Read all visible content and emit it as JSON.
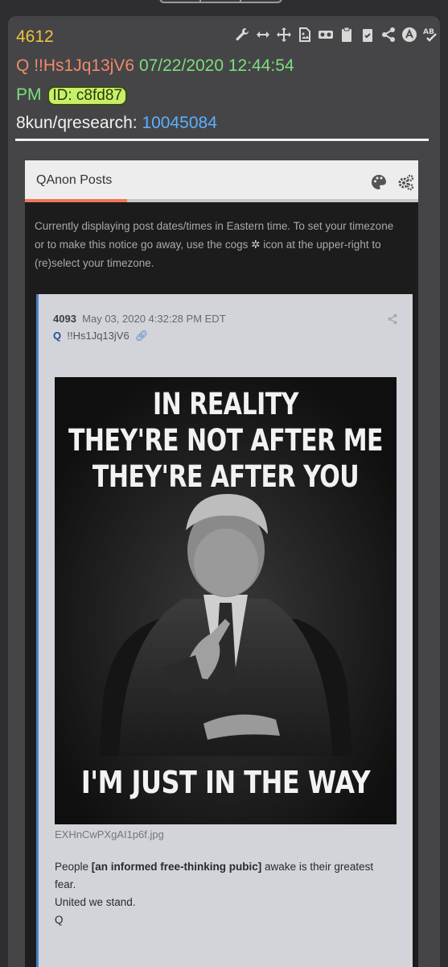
{
  "post": {
    "number": "4612",
    "author": "Q",
    "tripcode": "!!Hs1Jq13jV6",
    "date": "07/22/2020 12:44:54",
    "ampm": "PM",
    "id_label": "ID: c8fd87",
    "board": "8kun/qresearch:",
    "ref_number": "10045084"
  },
  "toolbar_icons": [
    "wrench-icon",
    "resize-horizontal-icon",
    "move-icon",
    "image-file-icon",
    "vr-goggles-icon",
    "clipboard-icon",
    "clipboard-check-icon",
    "share-icon",
    "a-circle-icon",
    "ab-spellcheck-icon"
  ],
  "embedded": {
    "title": "QAnon Posts",
    "notice_line1": "Currently displaying post dates/times in Eastern time. To set your timezone",
    "notice_line2a": "or to make this notice go away, use the cogs",
    "notice_line2b": "icon at the upper-right to",
    "notice_line3": "(re)select your timezone.",
    "inner_post": {
      "number": "4093",
      "date": "May 03, 2020 4:32:28 PM EDT",
      "author": "Q",
      "tripcode": "!!Hs1Jq13jV6",
      "meme_top_line1": "IN REALITY",
      "meme_top_line2": "THEY'RE NOT AFTER ME",
      "meme_top_line3": "THEY'RE AFTER YOU",
      "meme_bottom": "I'M JUST IN THE WAY",
      "filename": "EXHnCwPXgAI1p6f.jpg",
      "body_pre": "People ",
      "body_bold": "[an informed free-thinking pubic]",
      "body_post": " awake is their greatest fear.",
      "body_line2": "United we stand.",
      "body_line3": "Q"
    }
  },
  "colors": {
    "post_number": "#f0c23b",
    "author": "#f08a6a",
    "date": "#7dde7d",
    "link": "#5ab0ff",
    "id_badge": "#c6f06a"
  }
}
